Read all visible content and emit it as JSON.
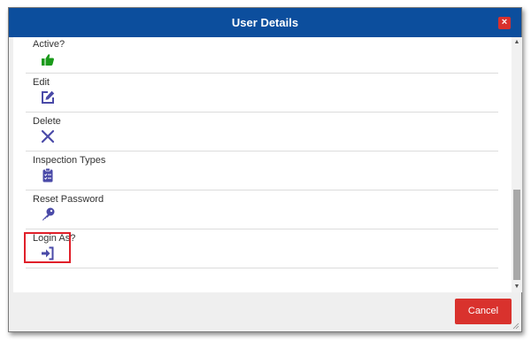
{
  "dialog": {
    "title": "User Details",
    "close_label": "×",
    "cancel_label": "Cancel"
  },
  "items": [
    {
      "label": "Active?",
      "icon": "thumbs-up-icon",
      "icon_color": "#1a9a1a"
    },
    {
      "label": "Edit",
      "icon": "edit-icon",
      "icon_color": "#4a4aa8"
    },
    {
      "label": "Delete",
      "icon": "close-icon",
      "icon_color": "#4a4aa8"
    },
    {
      "label": "Inspection Types",
      "icon": "clipboard-list-icon",
      "icon_color": "#4a4aa8"
    },
    {
      "label": "Reset Password",
      "icon": "key-icon",
      "icon_color": "#4a4aa8"
    },
    {
      "label": "Login As?",
      "icon": "sign-in-icon",
      "icon_color": "#4a4aa8"
    }
  ],
  "colors": {
    "titlebar": "#0c4e9d",
    "cancel_button": "#d9322d",
    "highlight_box": "#e0202a"
  }
}
